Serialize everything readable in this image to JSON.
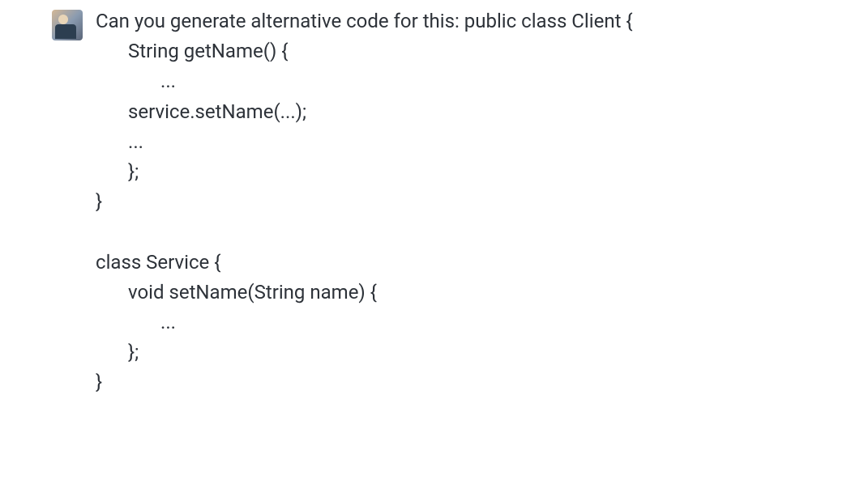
{
  "message": {
    "lead_text": "Can you generate alternative code for this: public class Client {",
    "lines": {
      "l1": "String getName() {",
      "l2": "...",
      "l3": "service.setName(...);",
      "l4": "...",
      "l5": "};",
      "l6": "}",
      "l7": "class Service {",
      "l8": "void setName(String name) {",
      "l9": "...",
      "l10": "};",
      "l11": "}"
    }
  },
  "avatar": {
    "alt": "User avatar"
  }
}
